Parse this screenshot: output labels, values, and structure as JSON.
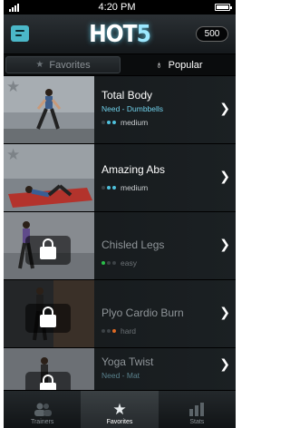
{
  "status_bar": {
    "carrier": "ııll",
    "time": "4:20 PM"
  },
  "header": {
    "logo_main": "HOT",
    "logo_number": "5",
    "points": "500"
  },
  "segments": [
    {
      "label": "Favorites",
      "icon": "star-icon",
      "selected": false
    },
    {
      "label": "Popular",
      "icon": "flame-icon",
      "selected": true
    }
  ],
  "workouts": [
    {
      "title": "Total Body",
      "need": "Need - Dumbbells",
      "difficulty": "medium",
      "level": 2,
      "locked": false,
      "favorite_icon": "star-icon",
      "thumb": "dumbbell-lunge"
    },
    {
      "title": "Amazing Abs",
      "need": "",
      "difficulty": "medium",
      "level": 2,
      "locked": false,
      "favorite_icon": "star-icon",
      "thumb": "mat-crunch"
    },
    {
      "title": "Chisled Legs",
      "need": "",
      "difficulty": "easy",
      "level": 1,
      "locked": true,
      "thumb": "squat"
    },
    {
      "title": "Plyo Cardio Burn",
      "need": "",
      "difficulty": "hard",
      "level": 3,
      "locked": true,
      "thumb": "jump"
    },
    {
      "title": "Yoga Twist",
      "need": "Need - Mat",
      "difficulty": "",
      "level": 0,
      "locked": true,
      "thumb": "yoga"
    }
  ],
  "difficulty_colors": {
    "easy": "#2bbf4a",
    "medium": "#4fc1dc",
    "hard": "#e06a24"
  },
  "tabs": [
    {
      "label": "Trainers",
      "icon": "trainers-icon",
      "active": false
    },
    {
      "label": "Favorites",
      "icon": "star-icon",
      "active": true
    },
    {
      "label": "Stats",
      "icon": "stats-icon",
      "active": false
    }
  ]
}
